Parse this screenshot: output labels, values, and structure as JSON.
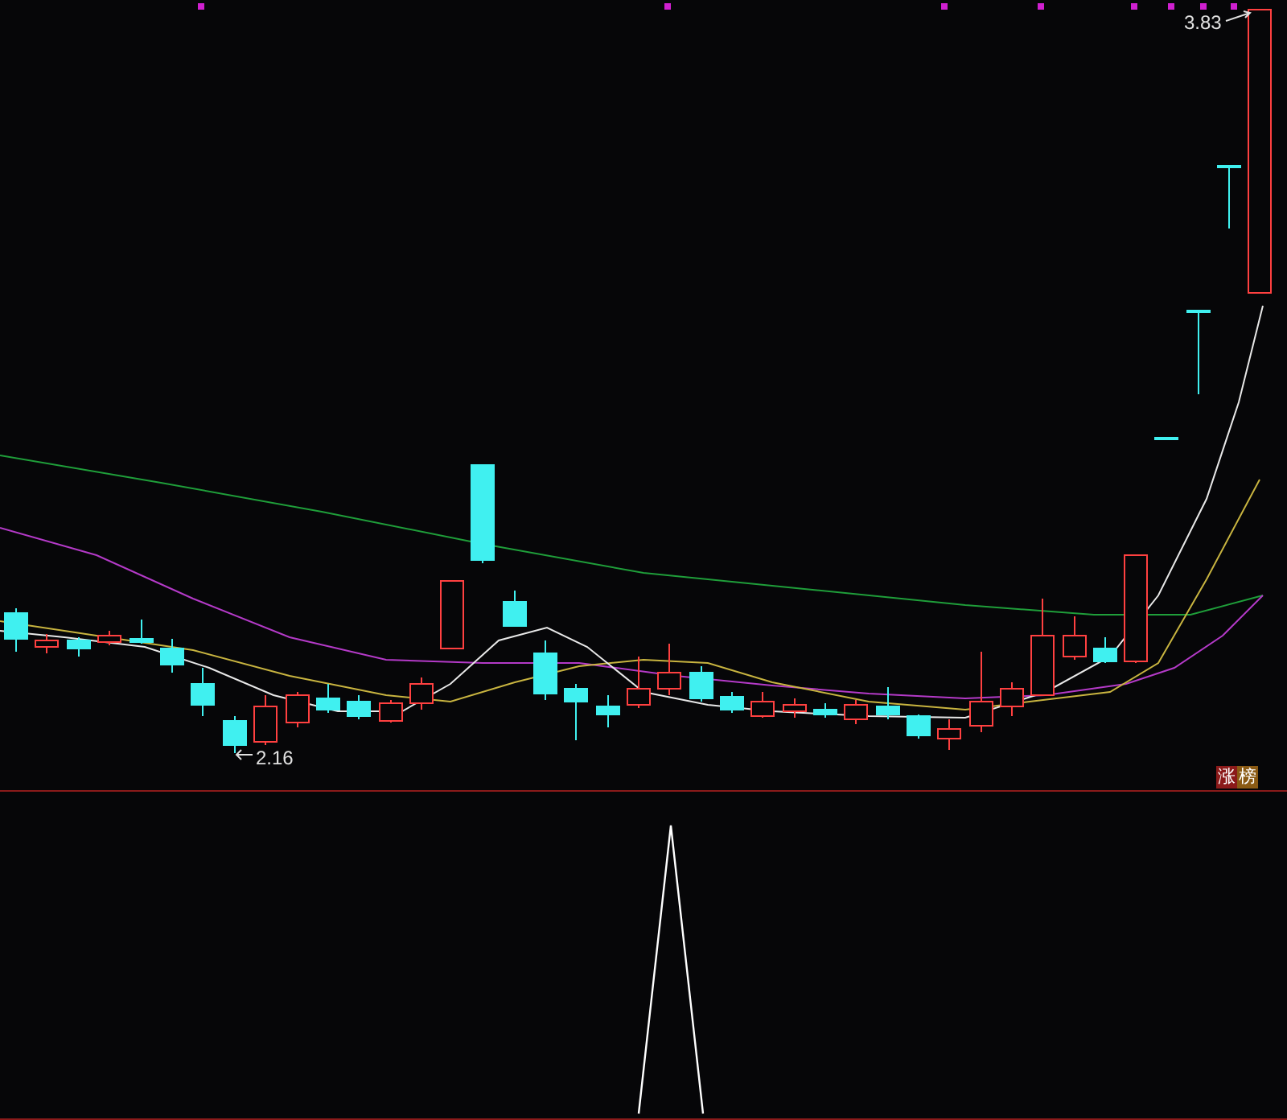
{
  "price_panel": {
    "high_label": "3.83",
    "low_label": "2.16",
    "tag": [
      {
        "text": "涨",
        "color": "#8b1a1a"
      },
      {
        "text": "榜",
        "color": "#8a5a14"
      }
    ]
  }
}
